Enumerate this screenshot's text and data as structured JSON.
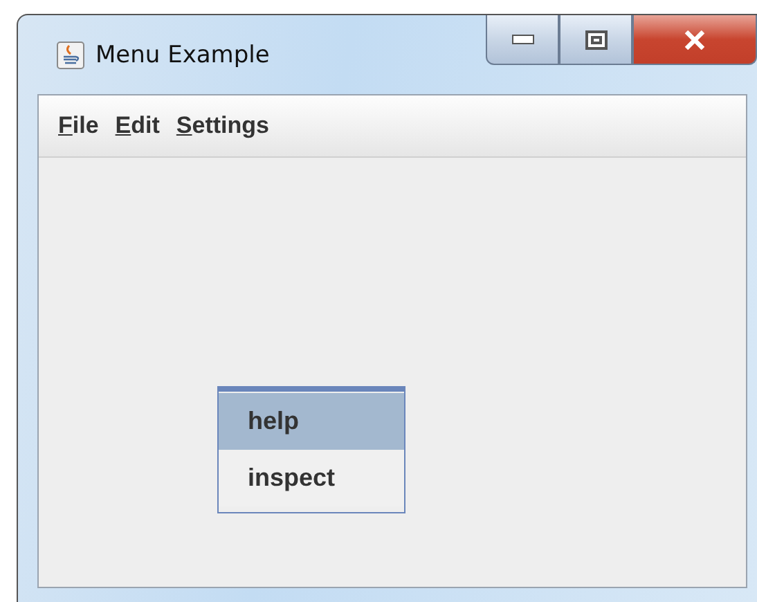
{
  "window": {
    "title": "Menu Example"
  },
  "menu_bar": [
    {
      "label": "File",
      "mnemonic": true
    },
    {
      "label": "Edit",
      "mnemonic": true
    },
    {
      "label": "Settings",
      "mnemonic": true
    }
  ],
  "popup_menu": [
    {
      "label": "help",
      "selected": true
    },
    {
      "label": "inspect",
      "selected": false
    }
  ]
}
